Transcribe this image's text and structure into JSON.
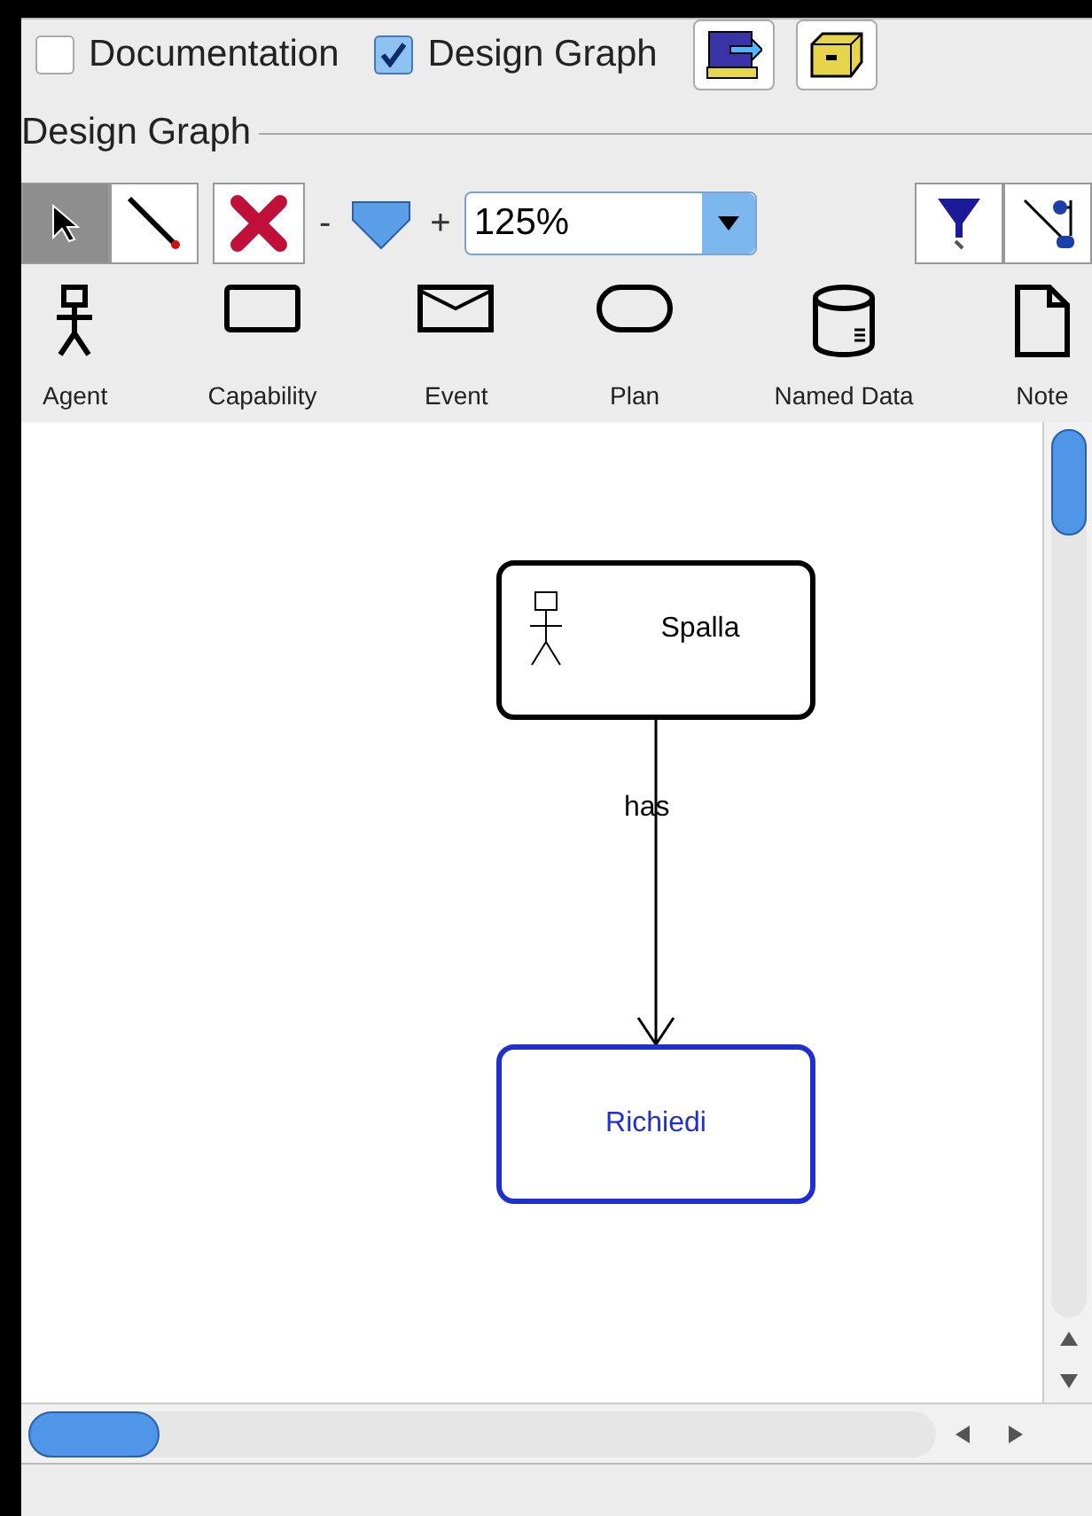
{
  "view_toggles": [
    {
      "label": "Documentation",
      "checked": false
    },
    {
      "label": "Design Graph",
      "checked": true
    }
  ],
  "group_title": "Design Graph",
  "toolbar": {
    "tools": [
      {
        "kind": "select",
        "selected": true
      },
      {
        "kind": "link",
        "selected": false
      }
    ],
    "zoom_minus": "-",
    "zoom_plus": "+",
    "zoom_value": "125%"
  },
  "palette": [
    {
      "kind": "agent",
      "label": "Agent"
    },
    {
      "kind": "capability",
      "label": "Capability"
    },
    {
      "kind": "event",
      "label": "Event"
    },
    {
      "kind": "plan",
      "label": "Plan"
    },
    {
      "kind": "data",
      "label": "Named Data"
    },
    {
      "kind": "note",
      "label": "Note"
    }
  ],
  "diagram": {
    "nodes": [
      {
        "kind": "agent",
        "label": "Spalla",
        "selected": false
      },
      {
        "kind": "goal",
        "label": "Richiedi",
        "selected": true
      }
    ],
    "edge_label": "has"
  }
}
